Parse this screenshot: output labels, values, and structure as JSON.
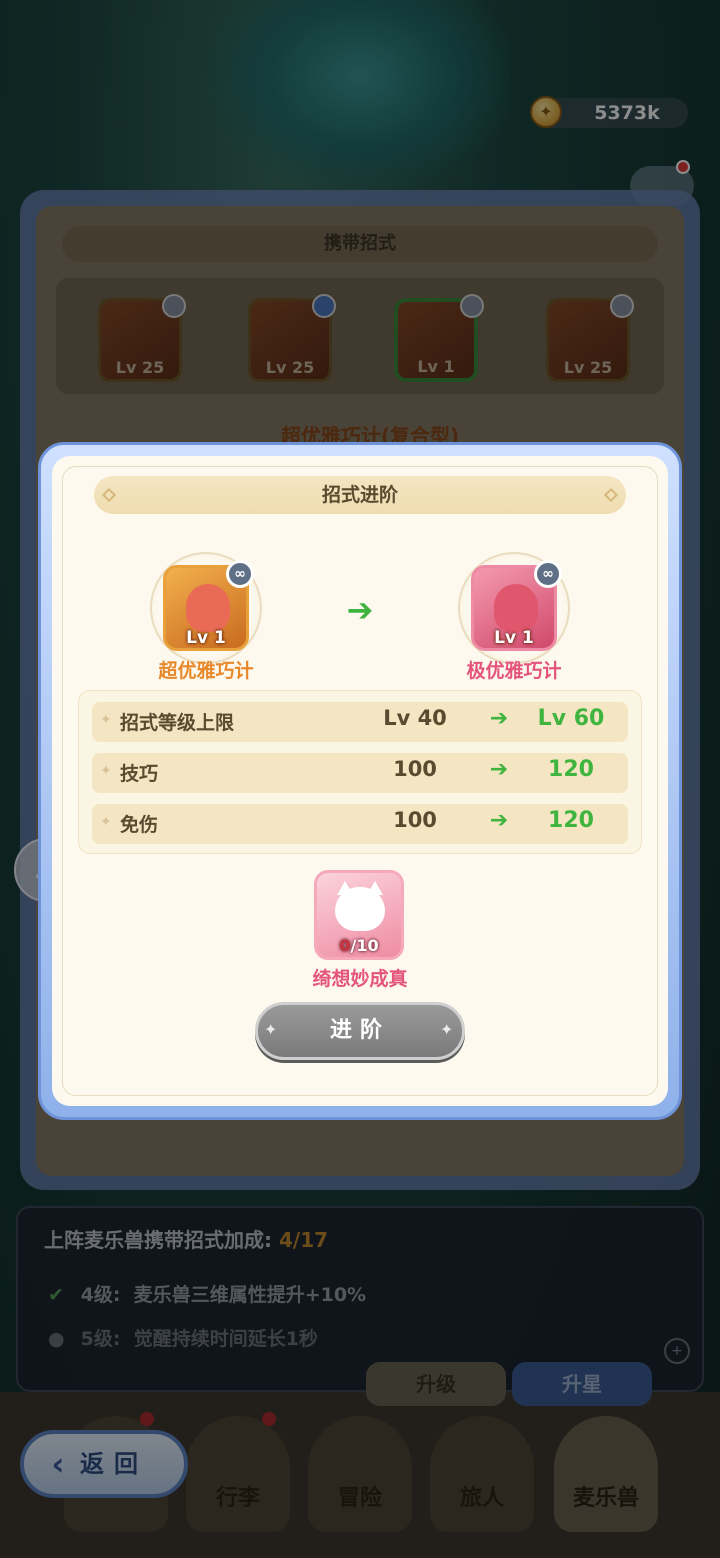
{
  "currency": {
    "value": "5373k",
    "icon": "coin-icon"
  },
  "carry_panel": {
    "title": "携带招式",
    "slots": [
      {
        "level": "Lv 25",
        "badge": "close-badge"
      },
      {
        "level": "Lv 25",
        "badge": "shield-badge"
      },
      {
        "level": "Lv 1",
        "badge": "link-badge",
        "selected": true
      },
      {
        "level": "Lv 25",
        "badge": "link-badge"
      }
    ],
    "skill_name_partial": "超优雅巧计(复合型)"
  },
  "modal": {
    "title": "招式进阶",
    "from_skill": {
      "level": "Lv 1",
      "name": "超优雅巧计"
    },
    "to_skill": {
      "level": "Lv 1",
      "name": "极优雅巧计"
    },
    "stats": [
      {
        "name": "招式等级上限",
        "old": "Lv 40",
        "new": "Lv 60"
      },
      {
        "name": "技巧",
        "old": "100",
        "new": "120"
      },
      {
        "name": "免伤",
        "old": "100",
        "new": "120"
      }
    ],
    "material": {
      "have": "0",
      "need": "/10",
      "name": "绮想妙成真"
    },
    "advance_button": "进阶"
  },
  "bonus": {
    "title": "上阵麦乐兽携带招式加成:",
    "count": "4/17",
    "lines": [
      {
        "level": "4级:",
        "text": "麦乐兽三维属性提升+10%",
        "unlocked": true
      },
      {
        "level": "5级:",
        "text": "觉醒持续时间延长1秒",
        "unlocked": false
      }
    ]
  },
  "bottom_buttons": {
    "upgrade": "升级",
    "star": "升星"
  },
  "tabs": [
    "行李",
    "冒险",
    "旅人",
    "麦乐兽"
  ],
  "back_button": "返回",
  "colors": {
    "accent_green": "#3fb43f",
    "from_orange": "#e7892a",
    "to_pink": "#e4547b"
  }
}
